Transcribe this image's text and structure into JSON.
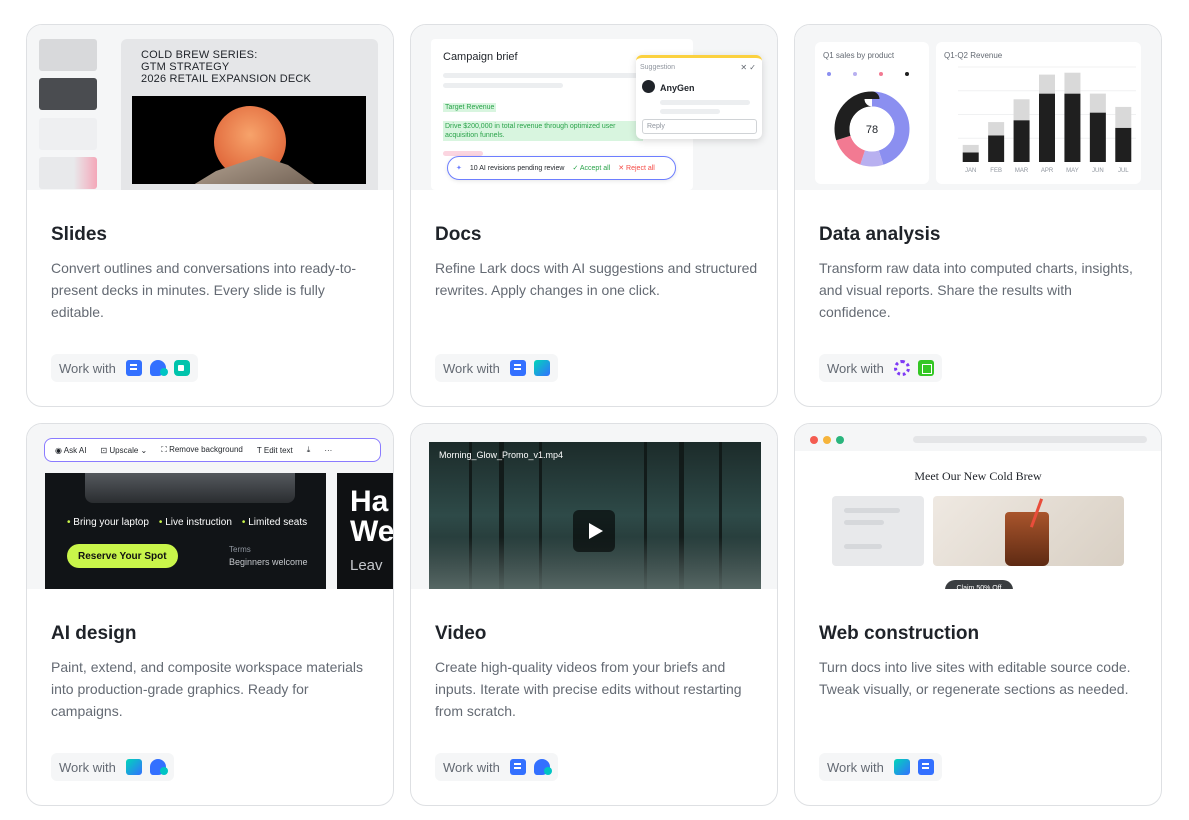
{
  "common": {
    "work_with": "Work with"
  },
  "cards": [
    {
      "title": "Slides",
      "desc": "Convert outlines and conversations into ready-to-present decks in minutes. Every slide is fully editable."
    },
    {
      "title": "Docs",
      "desc": "Refine Lark docs with AI suggestions and structured rewrites. Apply changes in one click."
    },
    {
      "title": "Data analysis",
      "desc": "Transform raw data into computed charts, insights, and visual reports. Share the results with confidence."
    },
    {
      "title": "AI design",
      "desc": "Paint, extend, and composite workspace materials into production-grade graphics. Ready for campaigns."
    },
    {
      "title": "Video",
      "desc": "Create high-quality videos from your briefs and inputs. Iterate with precise edits without restarting from scratch."
    },
    {
      "title": "Web construction",
      "desc": "Turn docs into live sites with editable source code. Tweak visually, or regenerate sections as needed."
    }
  ],
  "slides_preview": {
    "line1": "COLD BREW SERIES:",
    "line2": "GTM STRATEGY",
    "line3": "2026 RETAIL EXPANSION DECK"
  },
  "docs_preview": {
    "page_title": "Campaign brief",
    "target_label": "Target Revenue",
    "target_text": "Drive $200,000 in total revenue through optimized user acquisition funnels.",
    "suggestion_header": "Suggestion",
    "agent_name": "AnyGen",
    "input_placeholder": "Reply",
    "pending": "10 AI revisions pending review",
    "accept_all": "Accept all",
    "reject_all": "Reject all"
  },
  "data_preview": {
    "pie_title": "Q1 sales by product",
    "pie_center": "78",
    "bar_title": "Q1-Q2 Revenue"
  },
  "chart_data": [
    {
      "type": "pie",
      "title": "Q1 sales by product",
      "center_label": "78",
      "slices": [
        {
          "value": 45,
          "color": "#8b8ff0"
        },
        {
          "value": 10,
          "color": "#b8b0f0"
        },
        {
          "value": 15,
          "color": "#f27a92"
        },
        {
          "value": 30,
          "color": "#1f1f1f"
        }
      ]
    },
    {
      "type": "bar",
      "title": "Q1-Q2 Revenue",
      "categories": [
        "JAN",
        "FEB",
        "MAR",
        "APR",
        "MAY",
        "JUN",
        "JUL"
      ],
      "series": [
        {
          "values": [
            5,
            14,
            22,
            36,
            36,
            26,
            18
          ]
        },
        {
          "values": [
            4,
            7,
            11,
            10,
            11,
            10,
            11
          ]
        }
      ],
      "ylim": [
        0,
        50
      ],
      "colors": [
        "#1f1f1f",
        "#d9d9d9"
      ]
    }
  ],
  "design_preview": {
    "tool_ask": "Ask AI",
    "tool_upscale": "Upscale",
    "tool_remove_bg": "Remove background",
    "tool_edit_text": "Edit text",
    "b1": "Bring your laptop",
    "b2": "Live instruction",
    "b3": "Limited seats",
    "cta": "Reserve Your Spot",
    "terms": "Terms",
    "beginners": "Beginners welcome",
    "big1": "Ha",
    "big2": "We",
    "leave": "Leav"
  },
  "video_preview": {
    "filename": "Morning_Glow_Promo_v1.mp4"
  },
  "web_preview": {
    "heading": "Meet Our New Cold Brew",
    "claim": "Claim 50% Off"
  }
}
